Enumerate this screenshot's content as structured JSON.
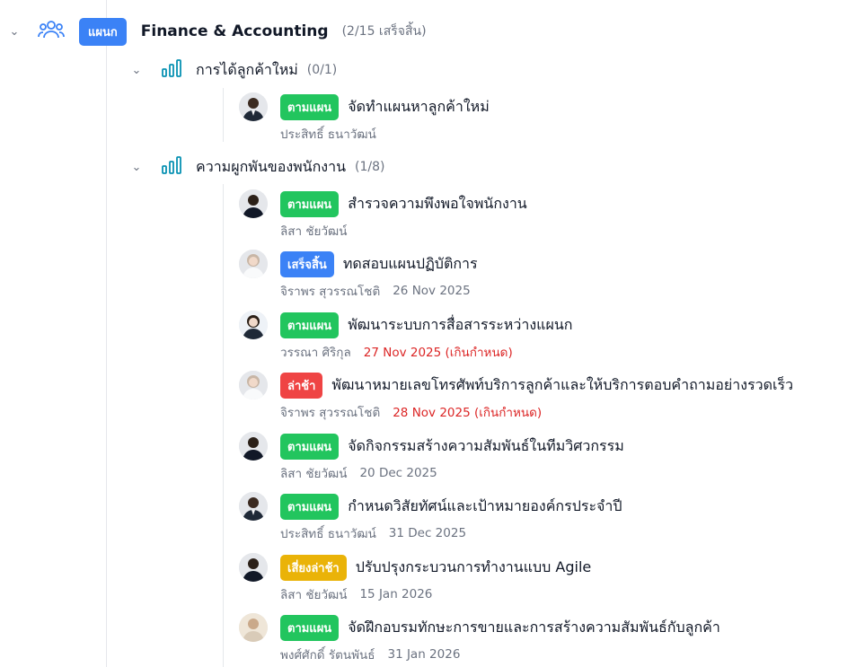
{
  "department": {
    "badge": "แผนก",
    "name": "Finance & Accounting",
    "count": "(2/15 เสร็จสิ้น)",
    "icon": "users-icon"
  },
  "groups": [
    {
      "name": "การได้ลูกค้าใหม่",
      "count": "(0/1)",
      "tasks": [
        {
          "status": "ตามแผน",
          "status_type": "ontrack",
          "title": "จัดทำแผนหาลูกค้าใหม่",
          "assignee": "ประสิทธิ์ ธนาวัฒน์",
          "date": "",
          "overdue": false
        }
      ]
    },
    {
      "name": "ความผูกพันของพนักงาน",
      "count": "(1/8)",
      "tasks": [
        {
          "status": "ตามแผน",
          "status_type": "ontrack",
          "title": "สำรวจความพึงพอใจพนักงาน",
          "assignee": "ลิสา ชัยวัฒน์",
          "date": "",
          "overdue": false
        },
        {
          "status": "เสร็จสิ้น",
          "status_type": "done",
          "title": "ทดสอบแผนปฏิบัติการ",
          "assignee": "จิราพร สุวรรณโชติ",
          "date": "26 Nov 2025",
          "overdue": false
        },
        {
          "status": "ตามแผน",
          "status_type": "ontrack",
          "title": "พัฒนาระบบการสื่อสารระหว่างแผนก",
          "assignee": "วรรณา ศิริกุล",
          "date": "27 Nov 2025 (เกินกำหนด)",
          "overdue": true
        },
        {
          "status": "ล่าช้า",
          "status_type": "late",
          "title": "พัฒนาหมายเลขโทรศัพท์บริการลูกค้าและให้บริการตอบคำถามอย่างรวดเร็ว",
          "assignee": "จิราพร สุวรรณโชติ",
          "date": "28 Nov 2025 (เกินกำหนด)",
          "overdue": true
        },
        {
          "status": "ตามแผน",
          "status_type": "ontrack",
          "title": "จัดกิจกรรมสร้างความสัมพันธ์ในทีมวิศวกรรม",
          "assignee": "ลิสา ชัยวัฒน์",
          "date": "20 Dec 2025",
          "overdue": false
        },
        {
          "status": "ตามแผน",
          "status_type": "ontrack",
          "title": "กำหนดวิสัยทัศน์และเป้าหมายองค์กรประจำปี",
          "assignee": "ประสิทธิ์ ธนาวัฒน์",
          "date": "31 Dec 2025",
          "overdue": false
        },
        {
          "status": "เสี่ยงล่าช้า",
          "status_type": "risk",
          "title": "ปรับปรุงกระบวนการทำงานแบบ Agile",
          "assignee": "ลิสา ชัยวัฒน์",
          "date": "15 Jan 2026",
          "overdue": false
        },
        {
          "status": "ตามแผน",
          "status_type": "ontrack",
          "title": "จัดฝึกอบรมทักษะการขายและการสร้างความสัมพันธ์กับลูกค้า",
          "assignee": "พงศ์ศักดิ์ รัตนพันธ์",
          "date": "31 Jan 2026",
          "overdue": false
        }
      ]
    }
  ],
  "colors": {
    "accent": "#3b82f6",
    "ontrack": "#22c55e",
    "late": "#ef4444",
    "risk": "#eab308",
    "overdue_text": "#dc2626",
    "group_icon": "#0891b2"
  }
}
